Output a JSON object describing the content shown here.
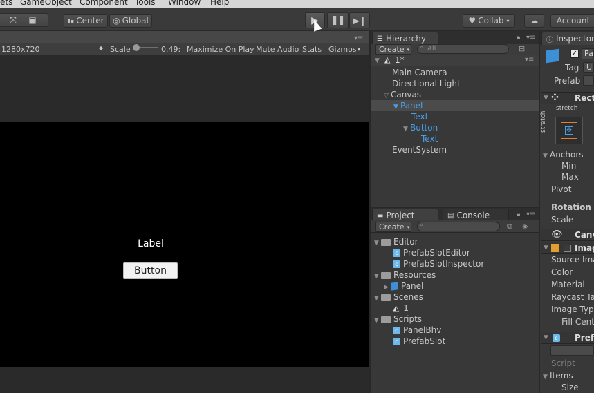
{
  "menu": [
    "ets",
    "GameObject",
    "Component",
    "Tools",
    "Window",
    "Help"
  ],
  "toolbar": {
    "pivot_label": "Center",
    "space_label": "Global",
    "collab_label": "Collab",
    "account_label": "Account"
  },
  "game": {
    "resolution": "1280x720",
    "scale_label": "Scale",
    "scale_value": "0.49:",
    "maximize_label": "Maximize On Play",
    "mute_label": "Mute Audio",
    "stats_label": "Stats",
    "gizmos_label": "Gizmos",
    "ui_label": "Label",
    "ui_button": "Button"
  },
  "hierarchy": {
    "tab": "Hierarchy",
    "create": "Create",
    "search_placeholder": "All",
    "scene": "1*",
    "items": [
      "Main Camera",
      "Directional Light",
      "Canvas",
      "Panel",
      "Text",
      "Button",
      "Text",
      "EventSystem"
    ]
  },
  "project": {
    "tab": "Project",
    "console_tab": "Console",
    "create": "Create",
    "items": [
      "Editor",
      "PrefabSlotEditor",
      "PrefabSlotInspector",
      "Resources",
      "Panel",
      "Scenes",
      "1",
      "Scripts",
      "PanelBhv",
      "PrefabSlot"
    ]
  },
  "inspector": {
    "tab": "Inspector",
    "name_partial": "Pa",
    "tag_label": "Tag",
    "tag_value": "Ur",
    "prefab_label": "Prefab",
    "rect_label": "Rect",
    "stretch_h": "stretch",
    "stretch_v": "stretch",
    "anchors": "Anchors",
    "min": "Min",
    "max": "Max",
    "pivot": "Pivot",
    "rotation": "Rotation",
    "scale": "Scale",
    "canvas": "Canv",
    "image": "Imag",
    "source_image": "Source Ima",
    "color": "Color",
    "material": "Material",
    "raycast": "Raycast Ta",
    "image_type": "Image Typ",
    "fill_center": "Fill Cent",
    "prefab_comp": "Pref",
    "script": "Script",
    "items": "Items",
    "size": "Size"
  },
  "colors": {
    "accent_blue": "#4aa0e8",
    "panel": "#383838",
    "game_bg": "#000000"
  }
}
